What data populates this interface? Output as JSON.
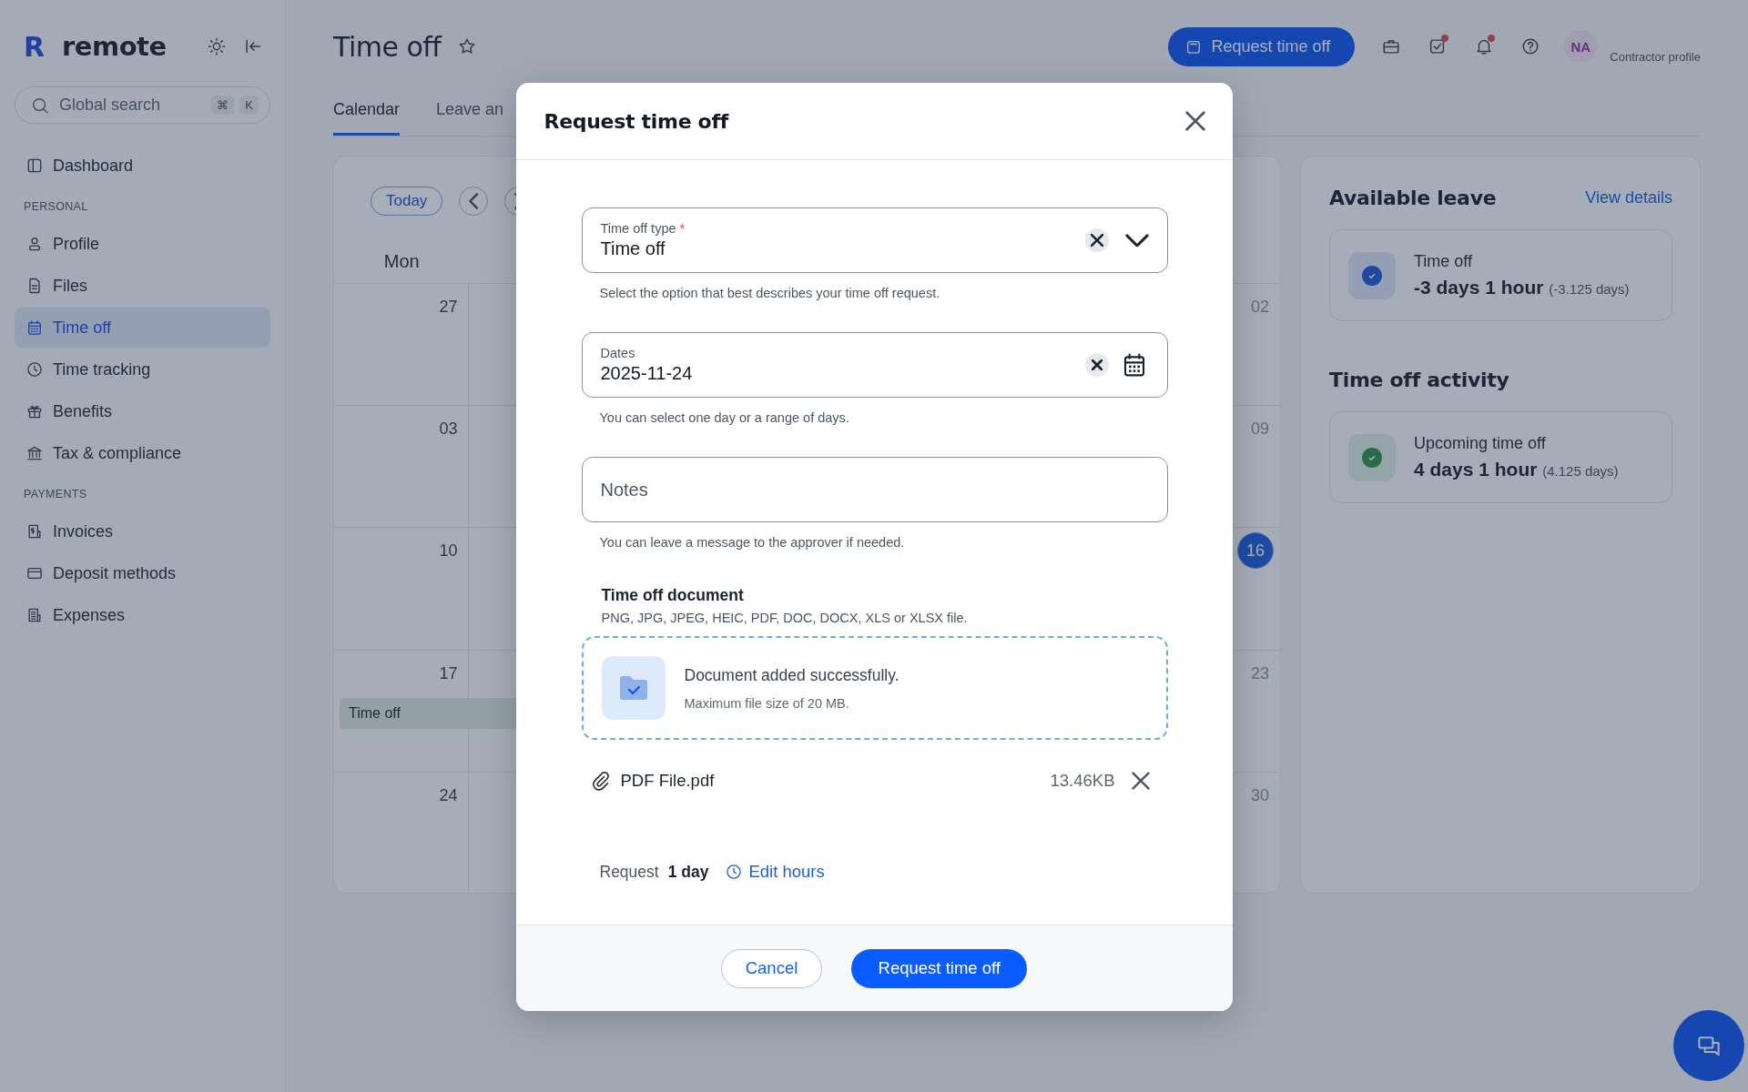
{
  "sidebar": {
    "logo_mark": "R",
    "logo": "remote",
    "search": {
      "placeholder": "Global search",
      "keys": [
        "⌘",
        "K"
      ]
    },
    "sections": [
      {
        "items": [
          {
            "label": "Dashboard",
            "selected": false
          }
        ]
      },
      {
        "heading": "PERSONAL",
        "items": [
          {
            "label": "Profile",
            "selected": false
          },
          {
            "label": "Files",
            "selected": false
          },
          {
            "label": "Time off",
            "selected": true
          },
          {
            "label": "Time tracking",
            "selected": false
          },
          {
            "label": "Benefits",
            "selected": false
          },
          {
            "label": "Tax & compliance",
            "selected": false
          }
        ]
      },
      {
        "heading": "PAYMENTS",
        "items": [
          {
            "label": "Invoices",
            "selected": false
          },
          {
            "label": "Deposit methods",
            "selected": false
          },
          {
            "label": "Expenses",
            "selected": false
          }
        ]
      }
    ]
  },
  "header": {
    "title": "Time off",
    "action": "Request time off",
    "icons": [
      {
        "badge": false
      },
      {
        "badge": true
      },
      {
        "badge": true
      },
      {
        "badge": false
      }
    ],
    "avatar": "NA",
    "profile": "Contractor profile"
  },
  "tabs": [
    {
      "label": "Calendar",
      "selected": true
    },
    {
      "label": "Leave an",
      "selected": false
    }
  ],
  "calendar": {
    "today": "Today",
    "weekdays": [
      "Mon"
    ],
    "weeks": [
      {
        "mon": "27",
        "sun": "02",
        "sun_today": false
      },
      {
        "mon": "03",
        "sun": "09",
        "sun_today": false
      },
      {
        "mon": "10",
        "sun": "16",
        "sun_today": true
      },
      {
        "mon": "17",
        "sun": "23",
        "sun_today": false,
        "event": "Time off"
      },
      {
        "mon": "24",
        "sun": "30",
        "sun_today": false
      }
    ]
  },
  "available_leave": {
    "title": "Available leave",
    "link": "View details",
    "items": [
      {
        "label": "Time off",
        "amount": "-3 days 1 hour",
        "detail": "(-3.125 days)"
      }
    ]
  },
  "activity": {
    "title": "Time off activity",
    "items": [
      {
        "label": "Upcoming time off",
        "amount": "4 days 1 hour",
        "detail": "(4.125 days)"
      }
    ]
  },
  "modal": {
    "title": "Request time off",
    "fields": [
      {
        "kind": "select",
        "label": "Time off type",
        "required_mark": "*",
        "value": "Time off",
        "help": "Select the option that best describes your time off request."
      },
      {
        "kind": "date",
        "label": "Dates",
        "value": "2025-11-24",
        "help": "You can select one day or a range of days."
      },
      {
        "kind": "textarea",
        "placeholder": "Notes",
        "help": "You can leave a message to the approver if needed."
      }
    ],
    "document": {
      "title": "Time off document",
      "formats": "PNG, JPG, JPEG, HEIC, PDF, DOC, DOCX, XLS or XLSX file.",
      "status": "Document added successfully.",
      "limit": "Maximum file size of 20 MB.",
      "file": {
        "name": "PDF File.pdf",
        "size": "13.46KB"
      }
    },
    "request": {
      "label": "Request",
      "amount": "1 day",
      "link": "Edit hours"
    },
    "buttons": [
      {
        "label": "Cancel",
        "kind": "secondary"
      },
      {
        "label": "Request time off",
        "kind": "primary"
      }
    ]
  }
}
